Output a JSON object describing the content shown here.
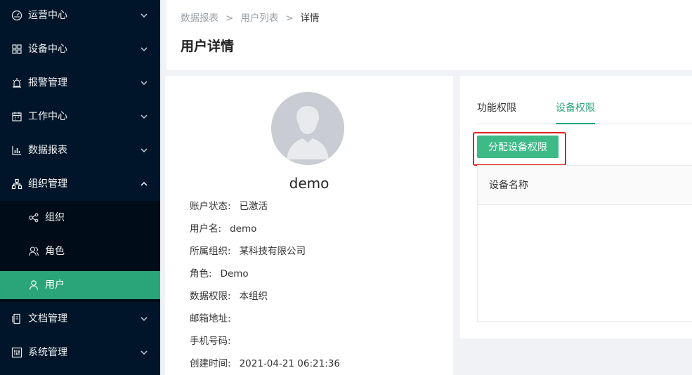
{
  "sidebar": {
    "items": [
      {
        "label": "运营中心",
        "icon": "dashboard-icon"
      },
      {
        "label": "设备中心",
        "icon": "grid-icon"
      },
      {
        "label": "报警管理",
        "icon": "alarm-icon"
      },
      {
        "label": "工作中心",
        "icon": "calendar-icon"
      },
      {
        "label": "数据报表",
        "icon": "bar-chart-icon"
      },
      {
        "label": "组织管理",
        "icon": "org-icon",
        "expanded": true,
        "children": [
          {
            "label": "组织",
            "icon": "org-structure-icon"
          },
          {
            "label": "角色",
            "icon": "roles-icon"
          },
          {
            "label": "用户",
            "icon": "user-icon",
            "active": true
          }
        ]
      },
      {
        "label": "文档管理",
        "icon": "document-icon"
      },
      {
        "label": "系统管理",
        "icon": "settings-icon"
      }
    ]
  },
  "breadcrumb": [
    "数据报表",
    "用户列表",
    "详情"
  ],
  "breadcrumb_separator": ">",
  "page_title": "用户详情",
  "user": {
    "name": "demo",
    "fields": [
      {
        "label": "账户状态:",
        "value": "已激活"
      },
      {
        "label": "用户名:",
        "value": "demo"
      },
      {
        "label": "所属组织:",
        "value": "某科技有限公司"
      },
      {
        "label": "角色:",
        "value": "Demo"
      },
      {
        "label": "数据权限:",
        "value": "本组织"
      },
      {
        "label": "邮箱地址:",
        "value": ""
      },
      {
        "label": "手机号码:",
        "value": ""
      },
      {
        "label": "创建时间:",
        "value": "2021-04-21 06:21:36"
      }
    ]
  },
  "tabs": [
    {
      "label": "功能权限",
      "active": false
    },
    {
      "label": "设备权限",
      "active": true
    }
  ],
  "assign_button": "分配设备权限",
  "table": {
    "columns": [
      "设备名称"
    ],
    "rows": []
  },
  "colors": {
    "sidebar_bg": "#001529",
    "accent": "#2aa57a",
    "button": "#3dba86",
    "highlight": "#e02020"
  }
}
